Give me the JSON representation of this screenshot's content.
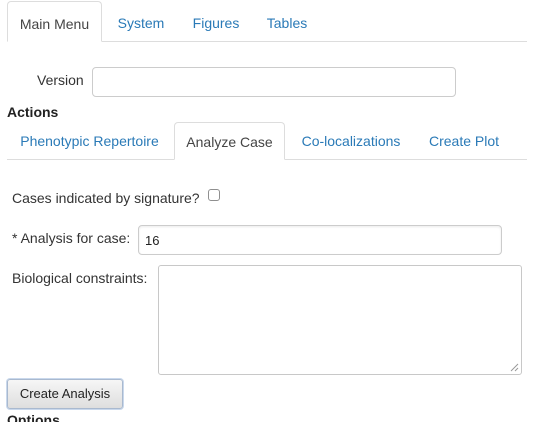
{
  "main_tabs": [
    "Main Menu",
    "System",
    "Figures",
    "Tables"
  ],
  "version": {
    "label": "Version",
    "value": ""
  },
  "actions": {
    "heading": "Actions",
    "tabs": [
      "Phenotypic Repertoire",
      "Analyze Case",
      "Co-localizations",
      "Create Plot"
    ]
  },
  "form": {
    "cases_by_signature": {
      "label": "Cases indicated by signature?",
      "checked": false
    },
    "analysis_for_case": {
      "label": "* Analysis for case:",
      "value": "16"
    },
    "biological_constraints": {
      "label": "Biological constraints:",
      "value": ""
    },
    "submit_label": "Create Analysis"
  },
  "options": {
    "heading": "Options"
  },
  "colors": {
    "link": "#2a7ab7",
    "active_tab_text": "#444444",
    "border": "#dddddd"
  }
}
